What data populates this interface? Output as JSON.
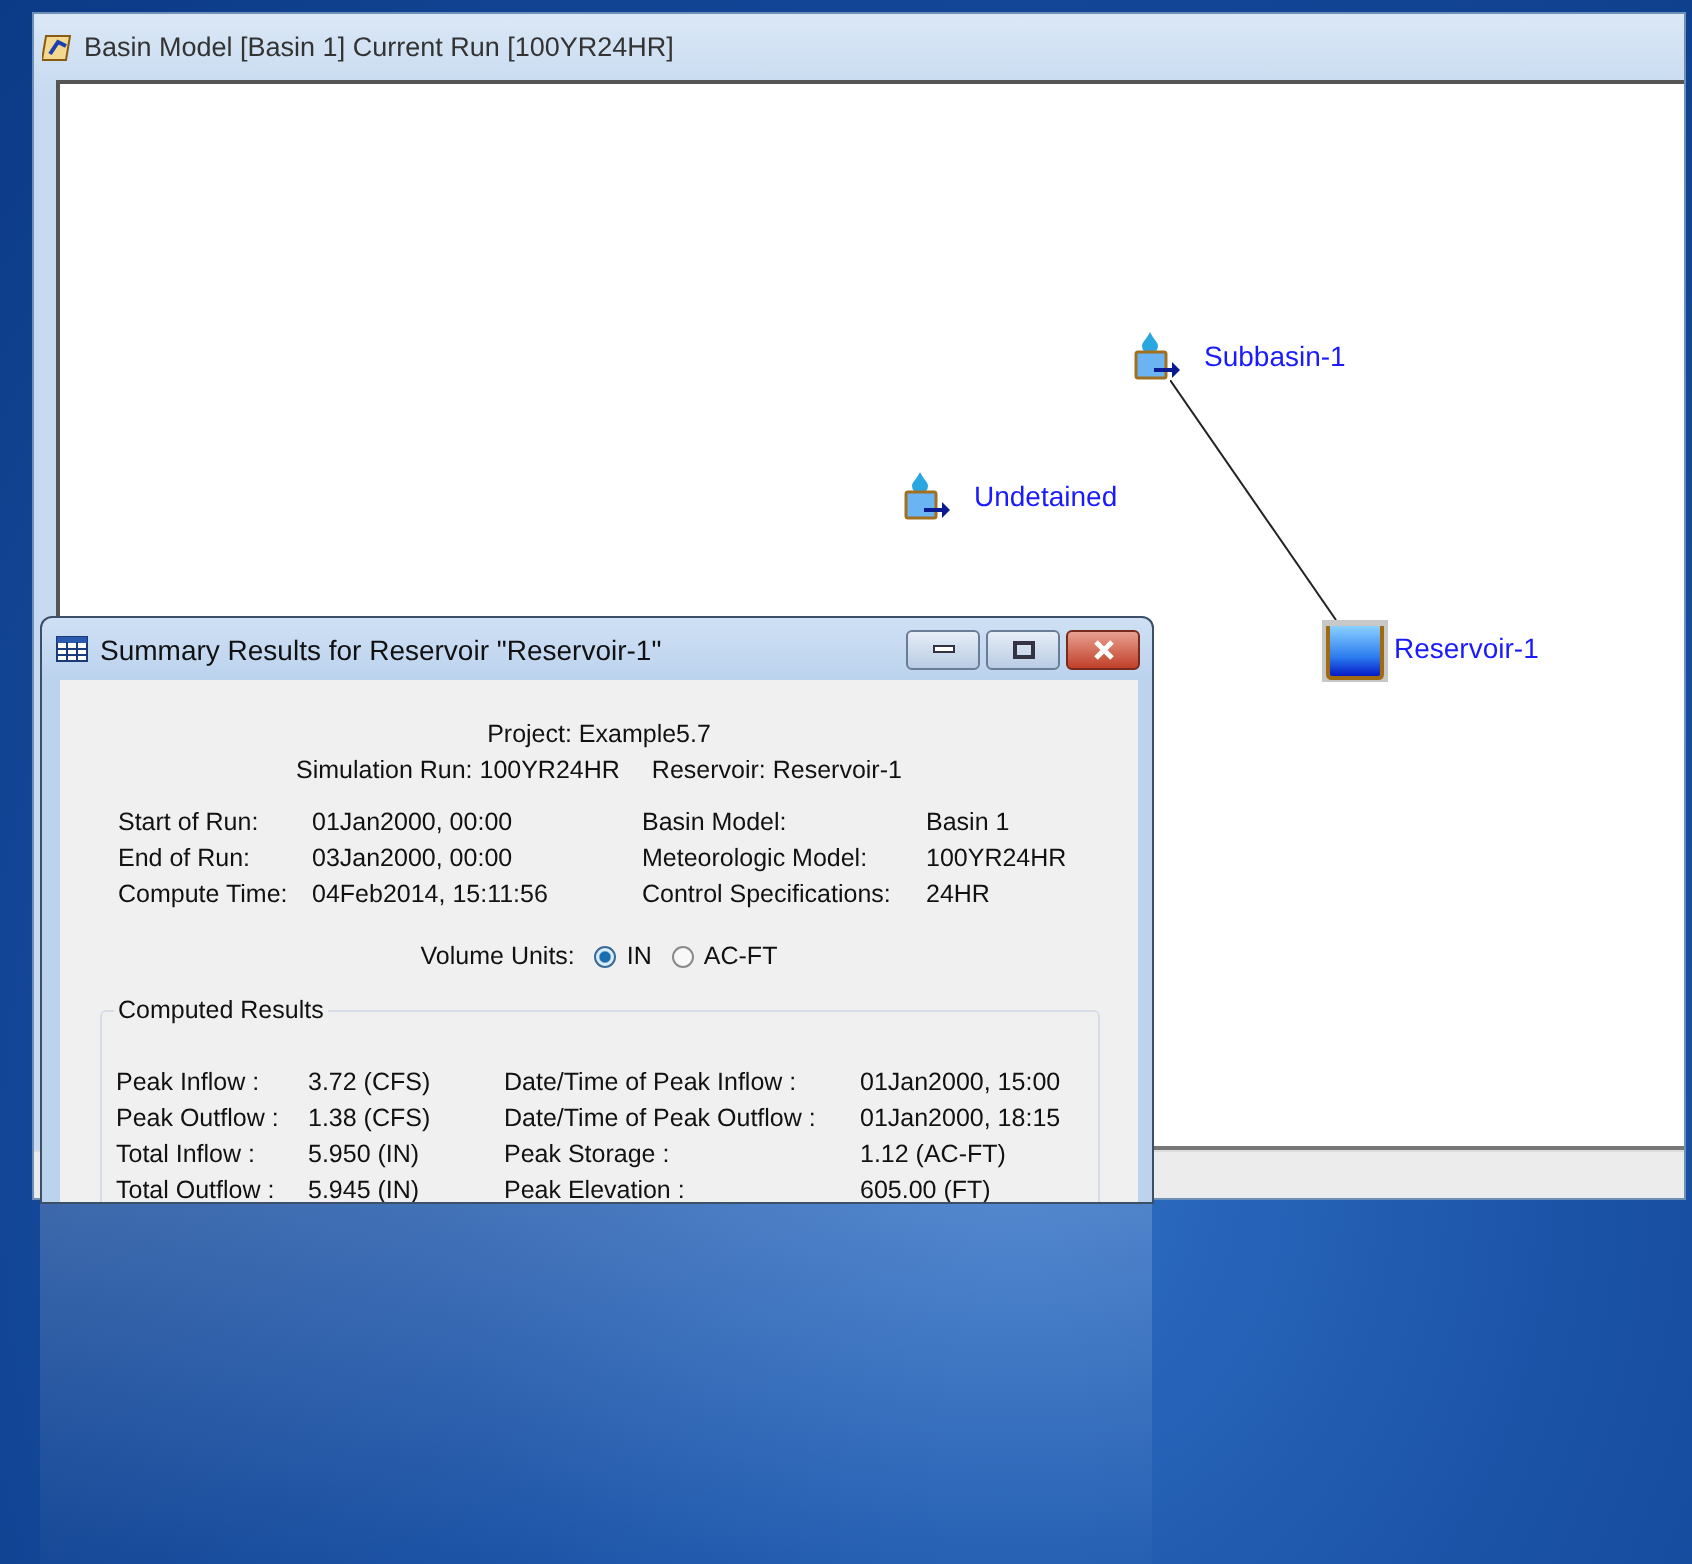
{
  "window": {
    "title": "Basin Model [Basin 1]  Current Run [100YR24HR]"
  },
  "basin_canvas": {
    "elements": [
      {
        "kind": "subbasin",
        "label": "Subbasin-1"
      },
      {
        "kind": "subbasin",
        "label": "Undetained"
      },
      {
        "kind": "reservoir",
        "label": "Reservoir-1"
      }
    ]
  },
  "summary_dialog": {
    "title": "Summary Results for Reservoir \"Reservoir-1\"",
    "project": "Project: Example5.7",
    "simulation_run": "Simulation Run: 100YR24HR",
    "reservoir": "Reservoir: Reservoir-1",
    "run_info": [
      {
        "label": "Start of Run:",
        "value": "01Jan2000, 00:00",
        "label_2": "Basin Model:",
        "value_2": "Basin 1"
      },
      {
        "label": "End of Run:",
        "value": "03Jan2000, 00:00",
        "label_2": "Meteorologic Model:",
        "value_2": "100YR24HR"
      },
      {
        "label": "Compute Time:",
        "value": "04Feb2014, 15:11:56",
        "label_2": "Control Specifications:",
        "value_2": "24HR"
      }
    ],
    "volume_units": {
      "label": "Volume Units:",
      "options": [
        {
          "label": "IN",
          "selected": true
        },
        {
          "label": "AC-FT",
          "selected": false
        }
      ]
    },
    "computed_results": {
      "title": "Computed Results",
      "rows": [
        {
          "label": "Peak Inflow :",
          "value": "3.72 (CFS)",
          "label_2": "Date/Time of Peak Inflow :",
          "value_2": "01Jan2000, 15:00"
        },
        {
          "label": "Peak Outflow :",
          "value": "1.38 (CFS)",
          "label_2": "Date/Time of Peak Outflow :",
          "value_2": "01Jan2000, 18:15"
        },
        {
          "label": "Total Inflow :",
          "value": "5.950 (IN)",
          "label_2": "Peak Storage :",
          "value_2": "1.12 (AC-FT)"
        },
        {
          "label": "Total Outflow :",
          "value": "5.945 (IN)",
          "label_2": "Peak Elevation :",
          "value_2": "605.00 (FT)"
        }
      ]
    }
  }
}
